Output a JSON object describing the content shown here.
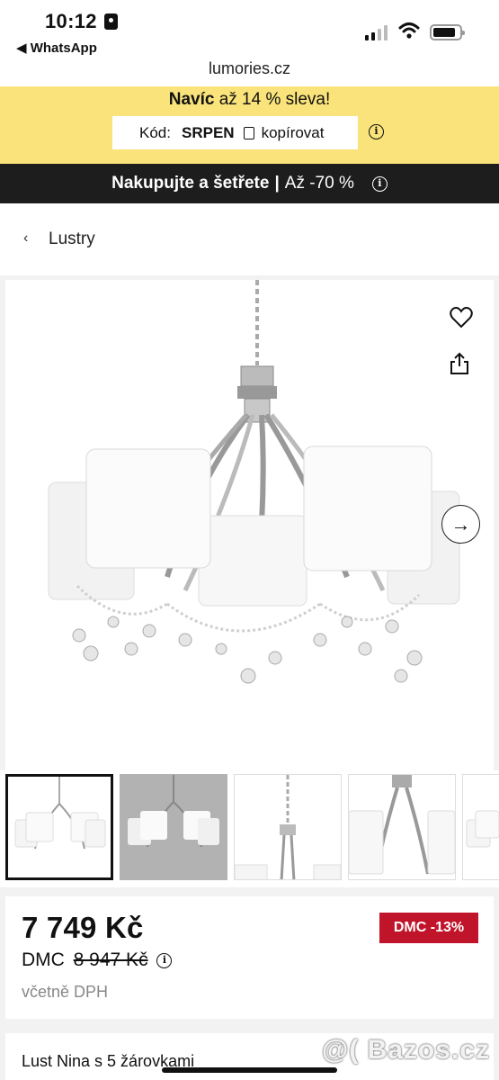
{
  "status_bar": {
    "time": "10:12",
    "back_app": "◀ WhatsApp"
  },
  "browser": {
    "url": "lumories.cz"
  },
  "promo": {
    "bold": "Navíc",
    "text": " až 14 % sleva!",
    "code_label": "Kód:",
    "code": "SRPEN",
    "copy_label": "kopírovat",
    "info": "i"
  },
  "banner": {
    "bold": "Nakupujte a šetřete",
    "separator": "|",
    "text": "Až -70 %",
    "info": "i"
  },
  "breadcrumb": {
    "chevron": "‹",
    "label": "Lustry"
  },
  "gallery": {
    "next_arrow": "→"
  },
  "pricing": {
    "price": "7 749 Kč",
    "dmc_label": "DMC",
    "dmc_price": "8 947 Kč",
    "info": "i",
    "vat_note": "včetně DPH",
    "discount_tag": "DMC -13%"
  },
  "product": {
    "name": "Lust Nina s 5 žárovkami"
  },
  "watermark": "@( Bazos.cz",
  "colors": {
    "promo_bg": "#f9e37a",
    "banner_bg": "#1d1d1d",
    "discount_red": "#c0142b"
  },
  "icons": [
    "heart-icon",
    "share-icon",
    "arrow-right-icon",
    "copy-icon",
    "info-icon",
    "chevron-left-icon"
  ]
}
